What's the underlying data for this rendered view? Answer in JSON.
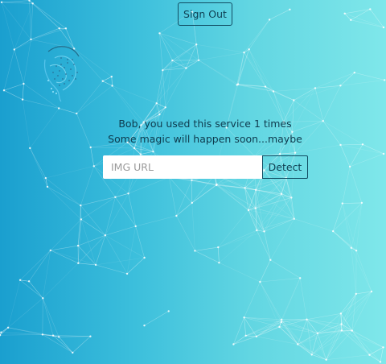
{
  "nav": {
    "signout_label": "Sign Out"
  },
  "logo": {
    "icon": "brain-icon"
  },
  "rank": {
    "line1": "Bob, you used this service 1 times",
    "line2": "Some magic will happen soon...maybe"
  },
  "form": {
    "input_placeholder": "IMG URL",
    "input_value": "",
    "detect_label": "Detect"
  },
  "colors": {
    "bg_left": "#1a9fcf",
    "bg_right": "#7fe7ea",
    "text": "#0e3a4d",
    "network": "#ffffff"
  }
}
